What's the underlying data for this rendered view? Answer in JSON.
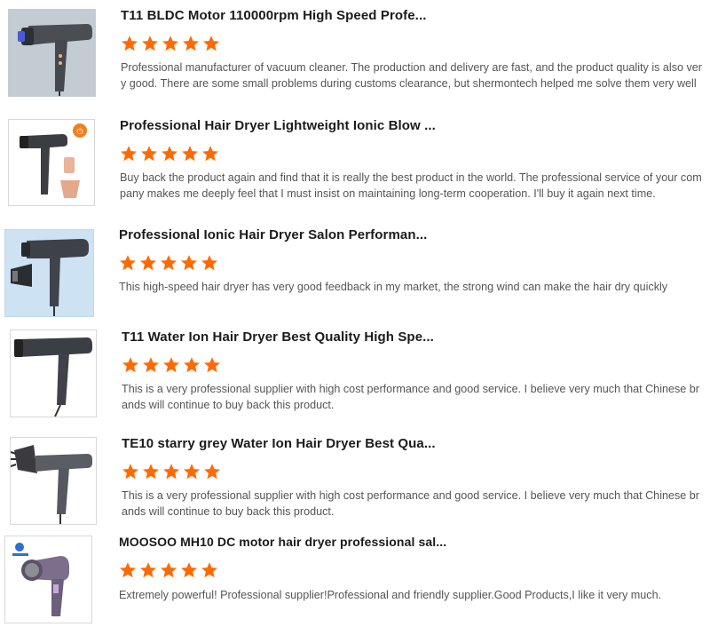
{
  "colors": {
    "star": "#ff6a00",
    "title": "#1b1b1b",
    "text": "#555555"
  },
  "reviews": [
    {
      "title": "T11 BLDC Motor 110000rpm High Speed Profe...",
      "rating": 5,
      "text": "Professional manufacturer of vacuum cleaner. The production and delivery are fast, and the product quality is also very good. There are some small problems during customs clearance, but shermontech helped me solve them very well"
    },
    {
      "title": "Professional Hair Dryer Lightweight Ionic Blow ...",
      "rating": 5,
      "text": "Buy back the product again and find that it is really the best product in the world. The professional service of your company makes me deeply feel that I must insist on maintaining long-term cooperation. I'll buy it again next time."
    },
    {
      "title": "Professional Ionic Hair Dryer Salon Performan...",
      "rating": 5,
      "text": "This high-speed hair dryer has very good feedback in my market, the strong wind can make the hair dry quickly"
    },
    {
      "title": "T11 Water Ion Hair Dryer Best Quality High Spe...",
      "rating": 5,
      "text": "This is a very professional supplier with high cost performance and good service. I believe very much that Chinese brands will continue to buy back this product."
    },
    {
      "title": "TE10 starry grey Water Ion Hair Dryer Best Qua...",
      "rating": 5,
      "text": "This is a very professional supplier with high cost performance and good service. I believe very much that Chinese brands will continue to buy back this product."
    },
    {
      "title": "MOOSOO MH10 DC motor hair dryer professional sal...",
      "rating": 5,
      "text": "Extremely powerful! Professional supplier!Professional and friendly supplier.Good Products,I like it very much."
    }
  ]
}
